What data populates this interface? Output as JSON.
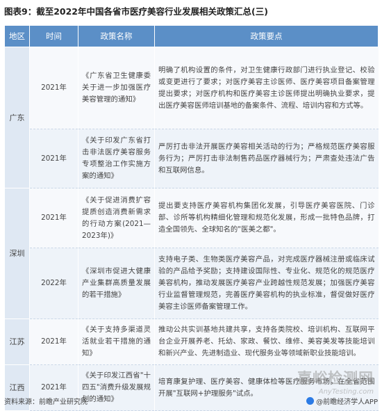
{
  "title": "图表9：截至2022年中国各省市医疗美容行业发展相关政策汇总(三)",
  "headers": [
    "地区",
    "时间",
    "政策名称",
    "政策要点"
  ],
  "regions": {
    "guangdong": "广东",
    "shenzhen": "深圳",
    "jiangsu": "江苏",
    "jiangxi": "江西"
  },
  "rows": [
    {
      "year": "2021年",
      "name": "《广东省卫生健康委关于进一步加强医疗美容管理的通知》",
      "points": "明确了机构设置的条件，对卫生健康行政部门进行执业登记、校验或变更进行了要求；对医疗美容主诊医师、医疗美容项目备案管理提出要求；对医疗机构和医疗美容主诊医师提出明确执业要求，提出医疗美容医师培训基地的备案条件、流程、培训内容和方式等。"
    },
    {
      "year": "2021年",
      "name": "《关于印发广东省打击非法医疗美容服务专项整治工作实施方案的通知》",
      "points": "严厉打击非法开展医疗美容相关活动的行为；严格规范医疗美容服务行为；严厉打击非法制售药品医疗器械行为；严肃查处违法广告和互联网信息。"
    },
    {
      "year": "2021年",
      "name": "《关于促进消费扩容提质创造消费新需求的行动方案(2021—2023年)》",
      "points": "提出要支持医疗美容机构集团化发展，引导医疗美容医院、门诊部、诊所等机构精细化管理和规范化发展，形成一批特色品牌，打造全国领先、全球知名的\"医美之都\"。"
    },
    {
      "year": "2022年",
      "name": "《深圳市促进大健康产业集群高质量发展的若干措施》",
      "points": "支持电子类、生物类医疗美容产品，对完成医疗器械注册或临床试验的产品给予奖励；支持建设国际性、专业化、规范化的规范医疗美容机构，推动发展医疗美容产业跨越性规范发展；加强医疗美容行业监督管理规范，完善医疗美容机构的执业标准，督促做好医疗美容主诊医师备案管理工作。"
    },
    {
      "year": "2021年",
      "name": "《关于支持多渠道灵活就业若干措施的通知》",
      "points": "推动公共实训基地共建共享，支持各类院校、培训机构、互联网平台企业开展养老、托幼、家政、餐饮、维修、美容美发等技能培训和新兴产业、先进制造业、现代服务业等领域新职业技能培训。"
    },
    {
      "year": "2021年",
      "name": "《关于印发江西省\"十四五\"消费升级发展规划的通知》",
      "points": "培育康复护理、医疗美容、健康体检等医疗服务市场，在全省范围开展\"互联网+护理服务\"试点。"
    }
  ],
  "footer": {
    "source": "资料来源：前瞻产业研究院",
    "brand": "@前瞻经济学人APP"
  },
  "watermark": {
    "main": "嘉峪检测网",
    "sub": "AnyTesting.com"
  }
}
